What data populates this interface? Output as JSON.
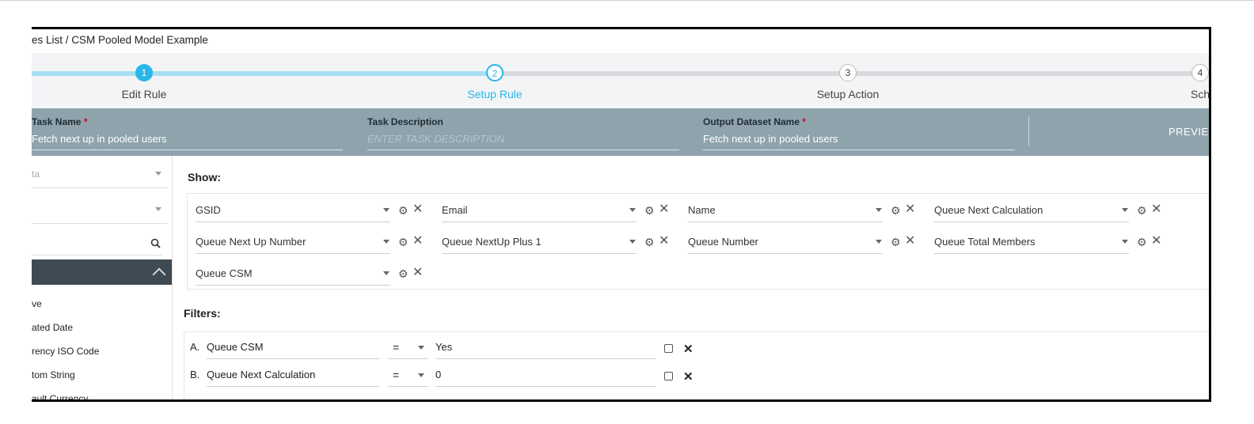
{
  "breadcrumb": "es List  /  CSM Pooled Model Example",
  "stepper": {
    "steps": [
      {
        "number": "1",
        "label": "Edit Rule",
        "state": "complete"
      },
      {
        "number": "2",
        "label": "Setup Rule",
        "state": "active"
      },
      {
        "number": "3",
        "label": "Setup Action",
        "state": "pending"
      },
      {
        "number": "4",
        "label": "Sche",
        "state": "pending"
      }
    ]
  },
  "taskbar": {
    "task_name_label": "Task Name",
    "task_name_value": "Fetch next up in pooled users",
    "task_description_label": "Task Description",
    "task_description_placeholder": "ENTER TASK DESCRIPTION",
    "output_dataset_label": "Output Dataset Name",
    "output_dataset_value": "Fetch next up in pooled users",
    "required_mark": "*",
    "preview_label": "PREVIE"
  },
  "sidebar": {
    "field1_text": "ta",
    "items": [
      "ve",
      "ated Date",
      "rency ISO Code",
      "tom String",
      "ault Currency"
    ]
  },
  "show": {
    "title": "Show:",
    "columns": [
      [
        "GSID",
        "Email",
        "Name",
        "Queue Next Calculation"
      ],
      [
        "Queue Next Up Number",
        "Queue NextUp Plus 1",
        "Queue Number",
        "Queue Total Members"
      ],
      [
        "Queue CSM"
      ]
    ]
  },
  "filters": {
    "title": "Filters:",
    "rows": [
      {
        "letter": "A.",
        "field": "Queue CSM",
        "operator": "=",
        "value": "Yes"
      },
      {
        "letter": "B.",
        "field": "Queue Next Calculation",
        "operator": "=",
        "value": "0"
      }
    ]
  },
  "colors": {
    "accent": "#29b6e8",
    "track_complete": "#a9dff2",
    "track_pending": "#d7d9dc",
    "taskbar_bg": "#8fa3ad",
    "sidebar_header_bg": "#3f4a52"
  }
}
